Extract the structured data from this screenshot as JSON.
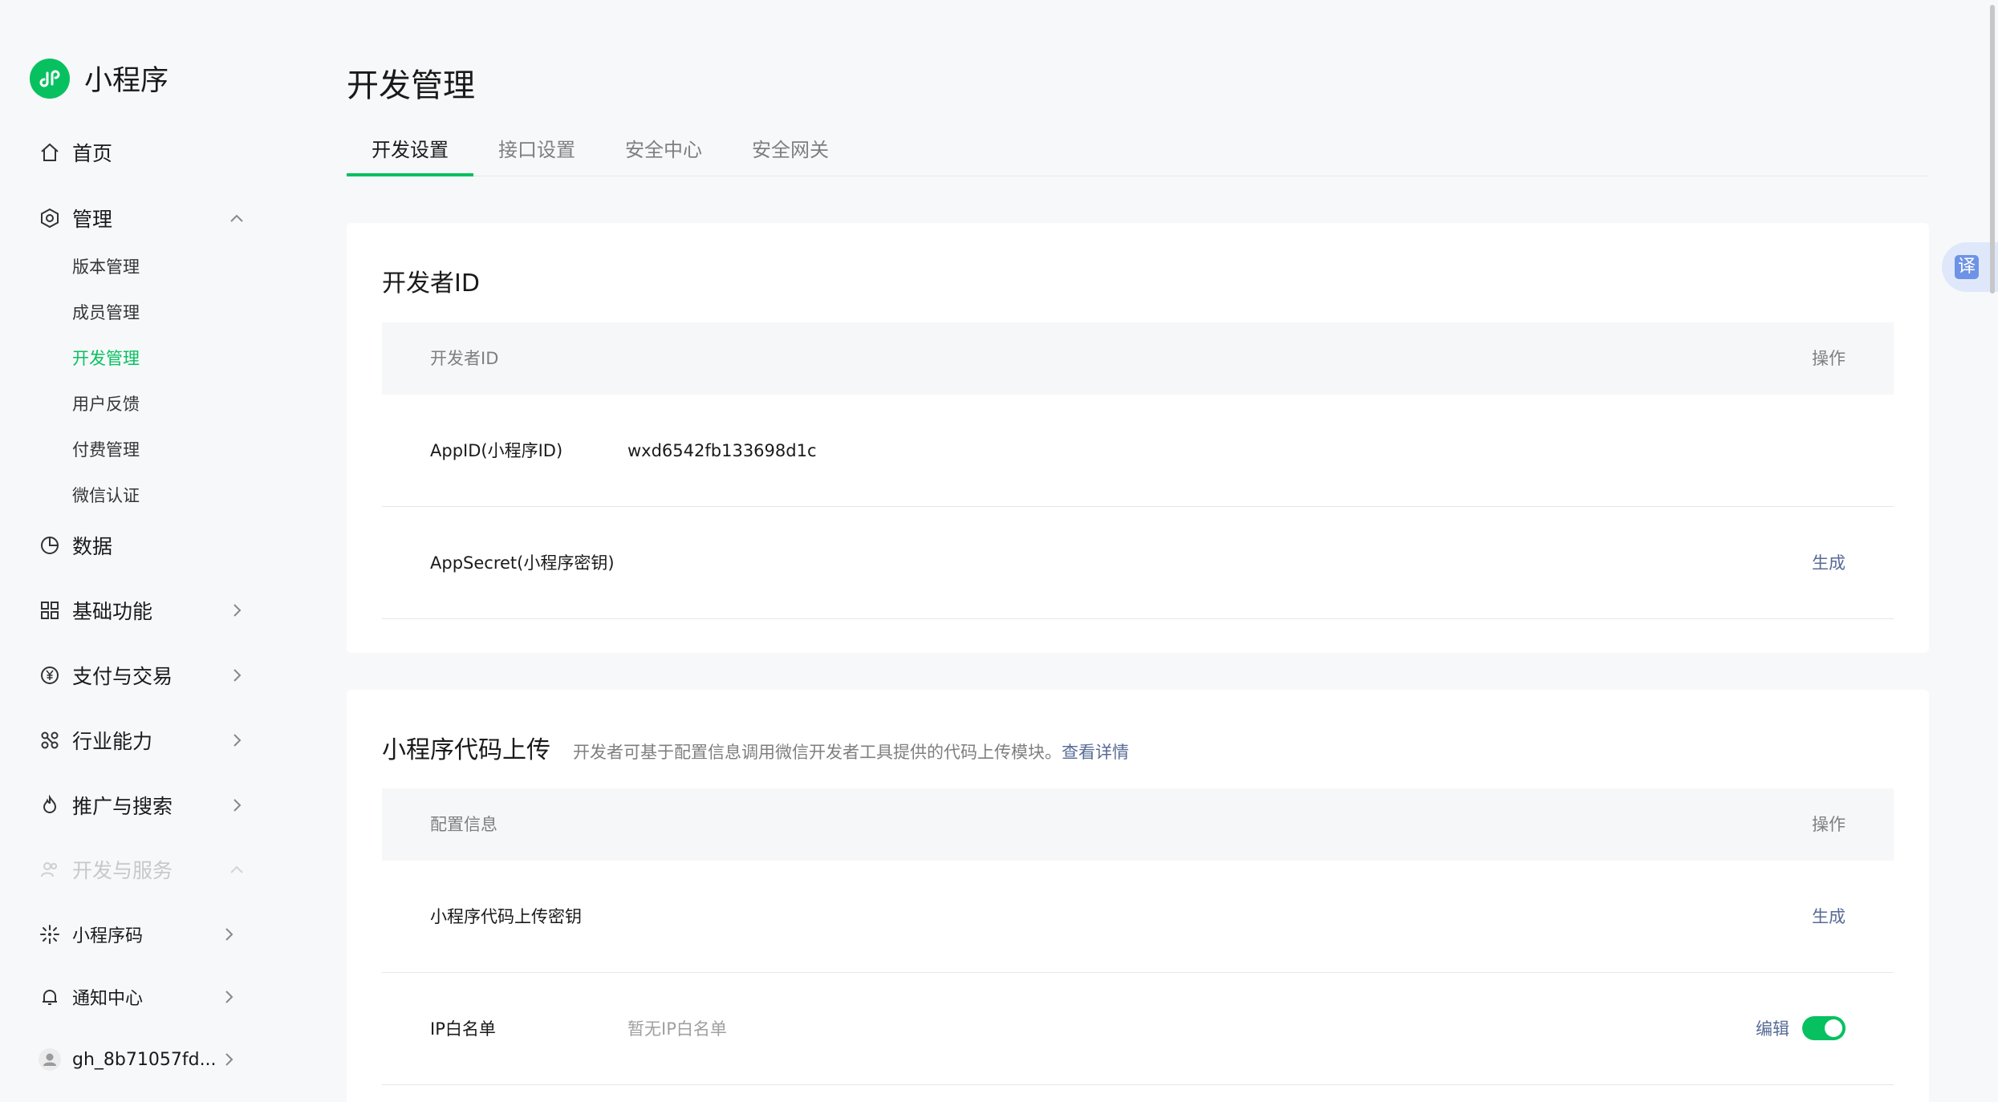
{
  "sidebar": {
    "logo_text": "小程序",
    "items": [
      {
        "label": "首页",
        "icon": "home-icon"
      },
      {
        "label": "管理",
        "icon": "gear-icon"
      },
      {
        "label": "数据",
        "icon": "pie-chart-icon"
      },
      {
        "label": "基础功能",
        "icon": "grid-icon"
      },
      {
        "label": "支付与交易",
        "icon": "yen-icon"
      },
      {
        "label": "行业能力",
        "icon": "nodes-icon"
      },
      {
        "label": "推广与搜索",
        "icon": "flame-icon"
      },
      {
        "label": "开发与服务",
        "icon": "people-icon"
      },
      {
        "label": "小程序码",
        "icon": "code-icon"
      },
      {
        "label": "通知中心",
        "icon": "bell-icon"
      },
      {
        "label": "gh_8b71057fd...",
        "icon": "user-avatar-icon"
      }
    ],
    "sub_items": [
      "版本管理",
      "成员管理",
      "开发管理",
      "用户反馈",
      "付费管理",
      "微信认证"
    ],
    "active_sub": "开发管理"
  },
  "main": {
    "title": "开发管理",
    "tabs": [
      "开发设置",
      "接口设置",
      "安全中心",
      "安全网关"
    ],
    "active_tab": "开发设置"
  },
  "developer_id_card": {
    "title": "开发者ID",
    "head_left": "开发者ID",
    "head_right": "操作",
    "rows": [
      {
        "key": "AppID(小程序ID)",
        "value": "wxd6542fb133698d1c",
        "action": ""
      },
      {
        "key": "AppSecret(小程序密钥)",
        "value": "",
        "action": "生成"
      }
    ]
  },
  "upload_card": {
    "title": "小程序代码上传",
    "desc": "开发者可基于配置信息调用微信开发者工具提供的代码上传模块。",
    "desc_link": "查看详情",
    "head_left": "配置信息",
    "head_right": "操作",
    "rows": [
      {
        "key": "小程序代码上传密钥",
        "value": "",
        "action": "生成"
      },
      {
        "key": "IP白名单",
        "value": "暂无IP白名单",
        "action": "编辑",
        "toggle_on": true
      }
    ]
  },
  "translate_label": "译",
  "colors": {
    "accent": "#07c160",
    "link": "#576b95"
  }
}
